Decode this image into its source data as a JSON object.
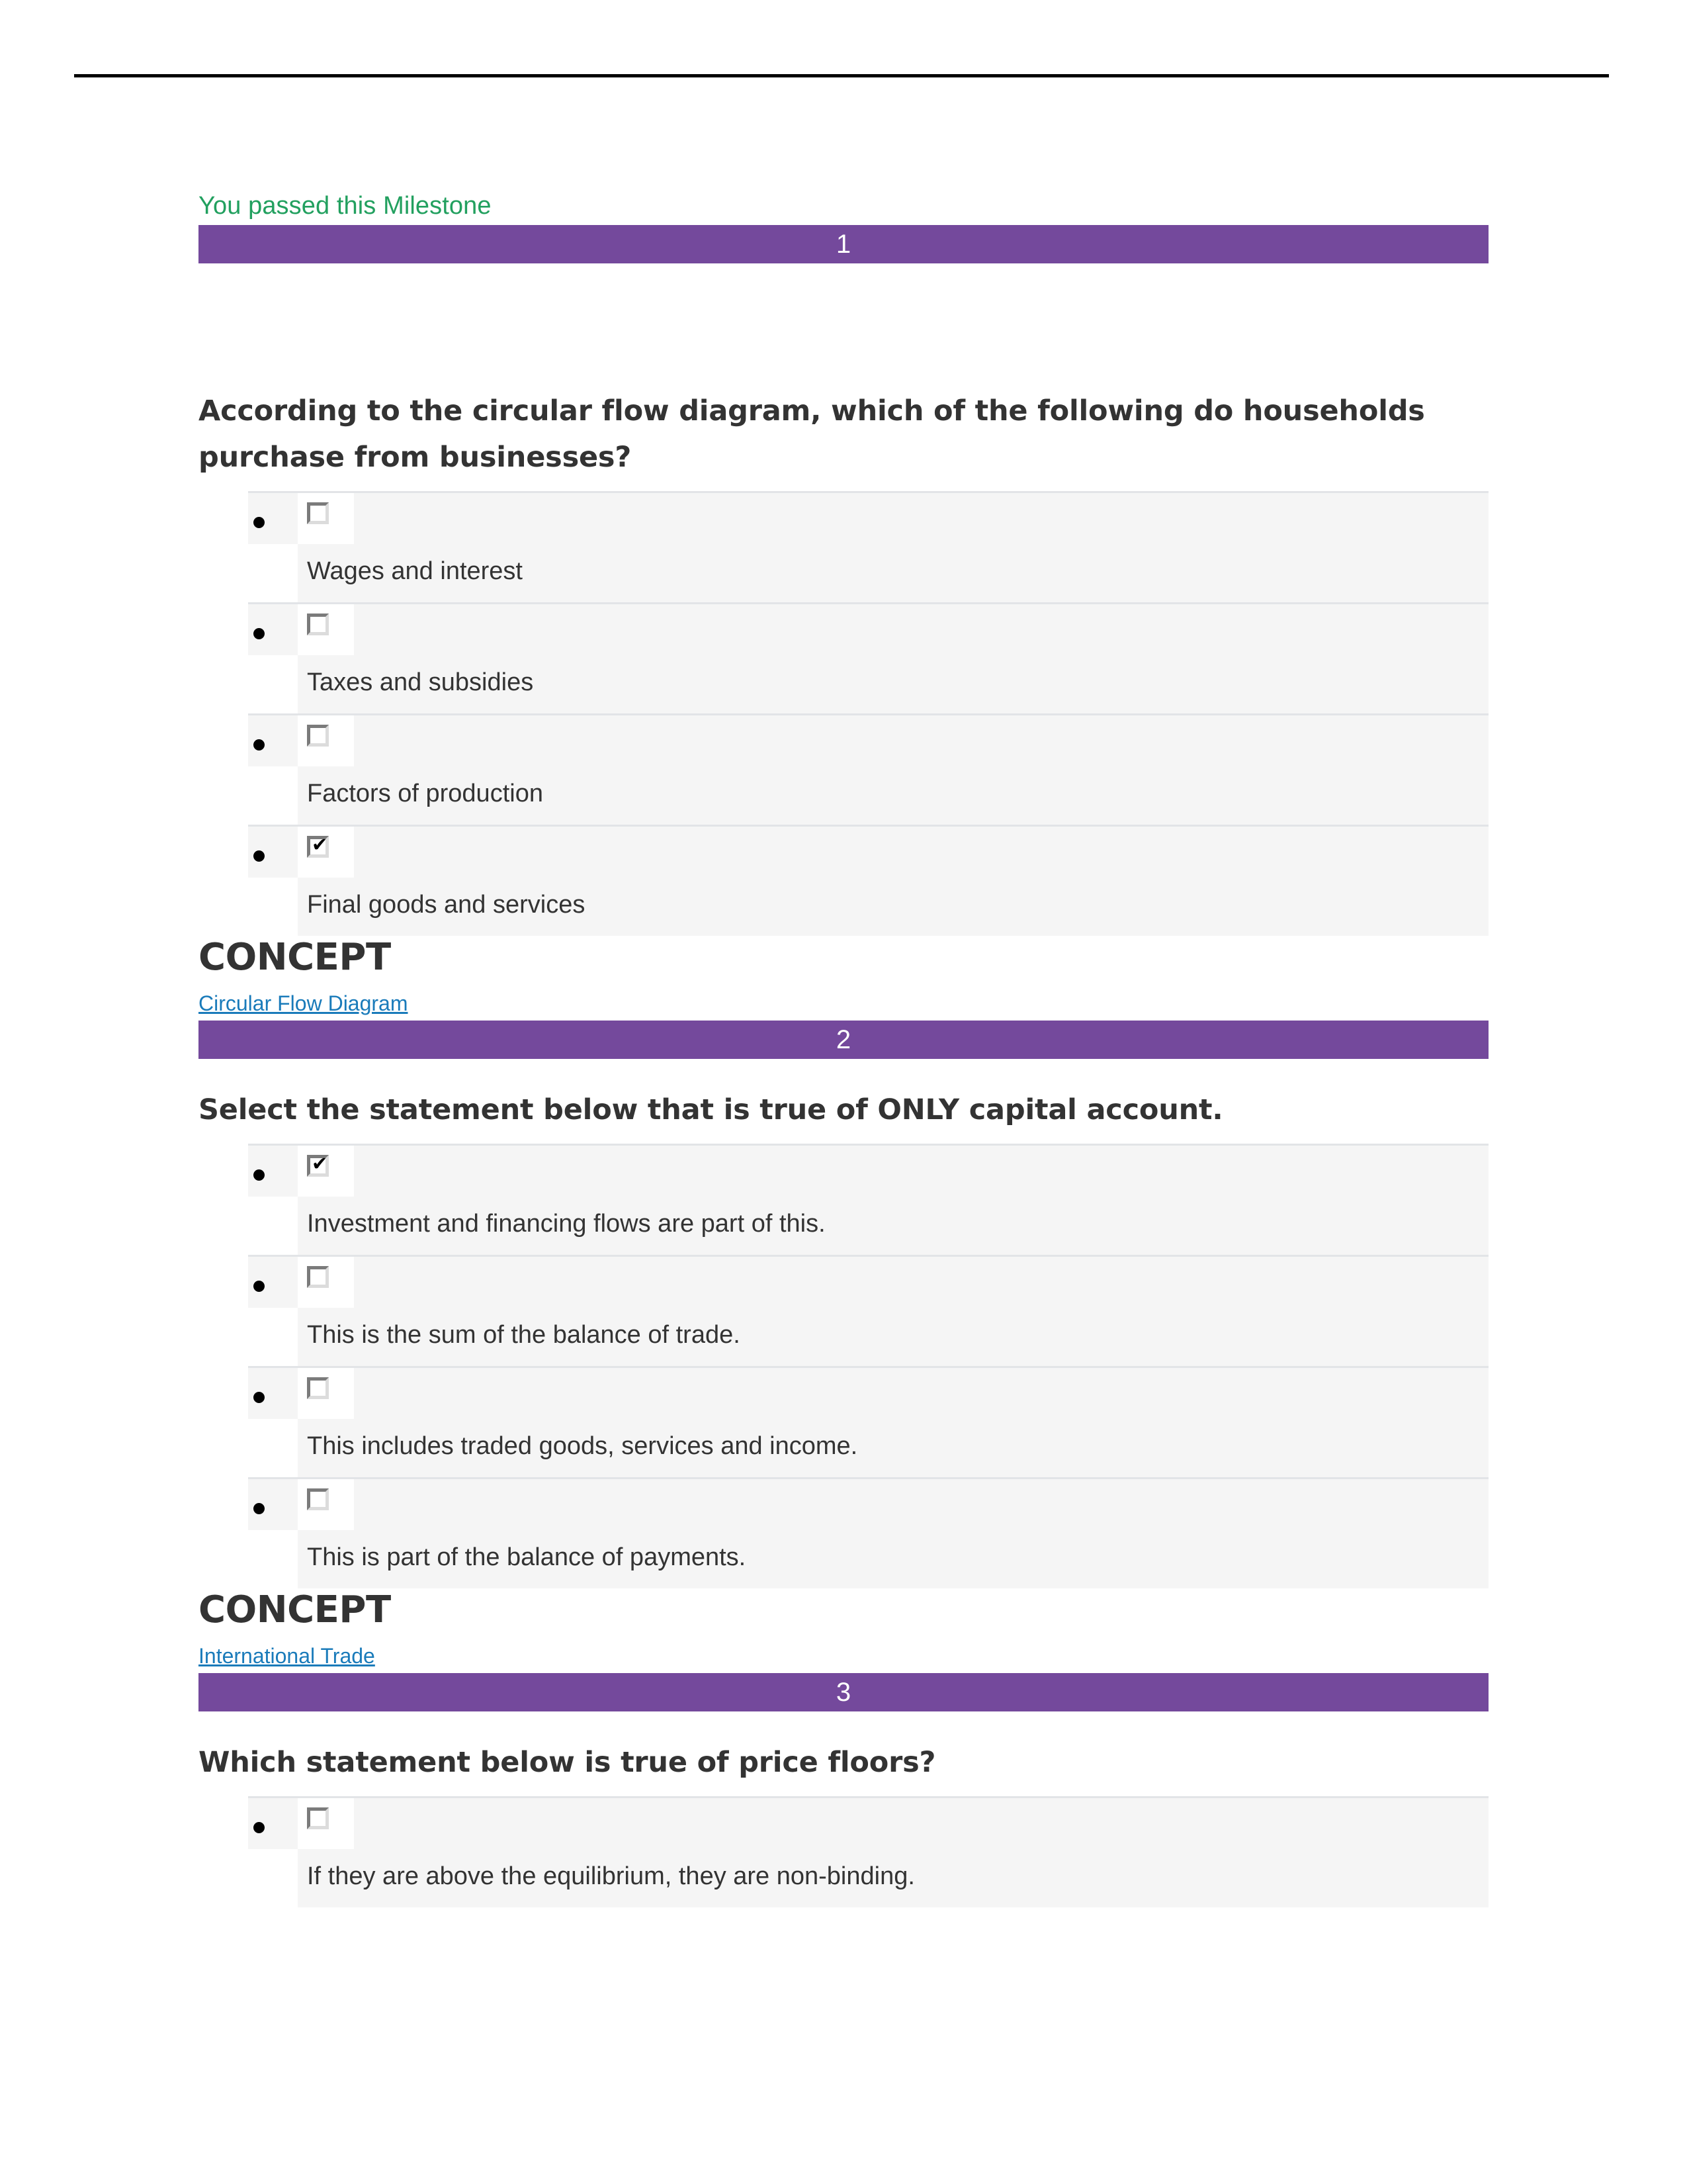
{
  "status_note": "You passed this Milestone",
  "colors": {
    "question_bar": "#74499c",
    "pass_text": "#22a05f",
    "link": "#1a7bba",
    "option_row": "#f5f5f5",
    "heading_text": "#333333"
  },
  "concept_label": "CONCEPT",
  "questions": [
    {
      "number": "1",
      "prompt": "According to the circular flow diagram, which of the following do households purchase from businesses?",
      "options": [
        {
          "label": "Wages and interest",
          "checked": false
        },
        {
          "label": "Taxes and subsidies",
          "checked": false
        },
        {
          "label": "Factors of production",
          "checked": false
        },
        {
          "label": "Final goods and services",
          "checked": true
        }
      ],
      "concept_link": "Circular Flow Diagram"
    },
    {
      "number": "2",
      "prompt": "Select the statement below that is true of ONLY capital account.",
      "options": [
        {
          "label": "Investment and financing flows are part of this.",
          "checked": true
        },
        {
          "label": "This is the sum of the balance of trade.",
          "checked": false
        },
        {
          "label": "This includes traded goods, services and income.",
          "checked": false
        },
        {
          "label": "This is part of the balance of payments.",
          "checked": false
        }
      ],
      "concept_link": "International Trade"
    },
    {
      "number": "3",
      "prompt": "Which statement below is true of price floors?",
      "options": [
        {
          "label": "If they are above the equilibrium, they are non-binding.",
          "checked": false
        }
      ]
    }
  ]
}
